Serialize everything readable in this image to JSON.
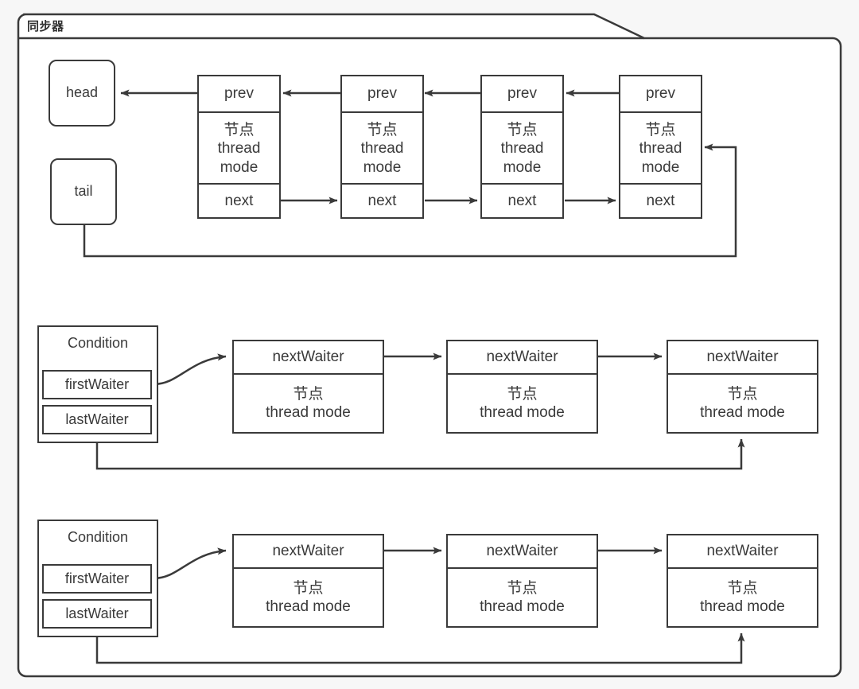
{
  "frame": {
    "title": "同步器",
    "border_color": "#3a3a3a",
    "fill_color": "#ffffff",
    "page_background": "#f7f7f7"
  },
  "queue": {
    "head_label": "head",
    "tail_label": "tail",
    "node_fields": {
      "prev": "prev",
      "body": "节点\nthread\nmode",
      "next": "next"
    },
    "nodes": [
      {
        "prev": "prev",
        "body": "节点\nthread\nmode",
        "next": "next"
      },
      {
        "prev": "prev",
        "body": "节点\nthread\nmode",
        "next": "next"
      },
      {
        "prev": "prev",
        "body": "节点\nthread\nmode",
        "next": "next"
      },
      {
        "prev": "prev",
        "body": "节点\nthread\nmode",
        "next": "next"
      }
    ]
  },
  "conditions": [
    {
      "title": "Condition",
      "first_waiter": "firstWaiter",
      "last_waiter": "lastWaiter",
      "waiters": [
        {
          "header": "nextWaiter",
          "body": "节点\nthread  mode"
        },
        {
          "header": "nextWaiter",
          "body": "节点\nthread  mode"
        },
        {
          "header": "nextWaiter",
          "body": "节点\nthread  mode"
        }
      ]
    },
    {
      "title": "Condition",
      "first_waiter": "firstWaiter",
      "last_waiter": "lastWaiter",
      "waiters": [
        {
          "header": "nextWaiter",
          "body": "节点\nthread  mode"
        },
        {
          "header": "nextWaiter",
          "body": "节点\nthread  mode"
        },
        {
          "header": "nextWaiter",
          "body": "节点\nthread  mode"
        }
      ]
    }
  ]
}
